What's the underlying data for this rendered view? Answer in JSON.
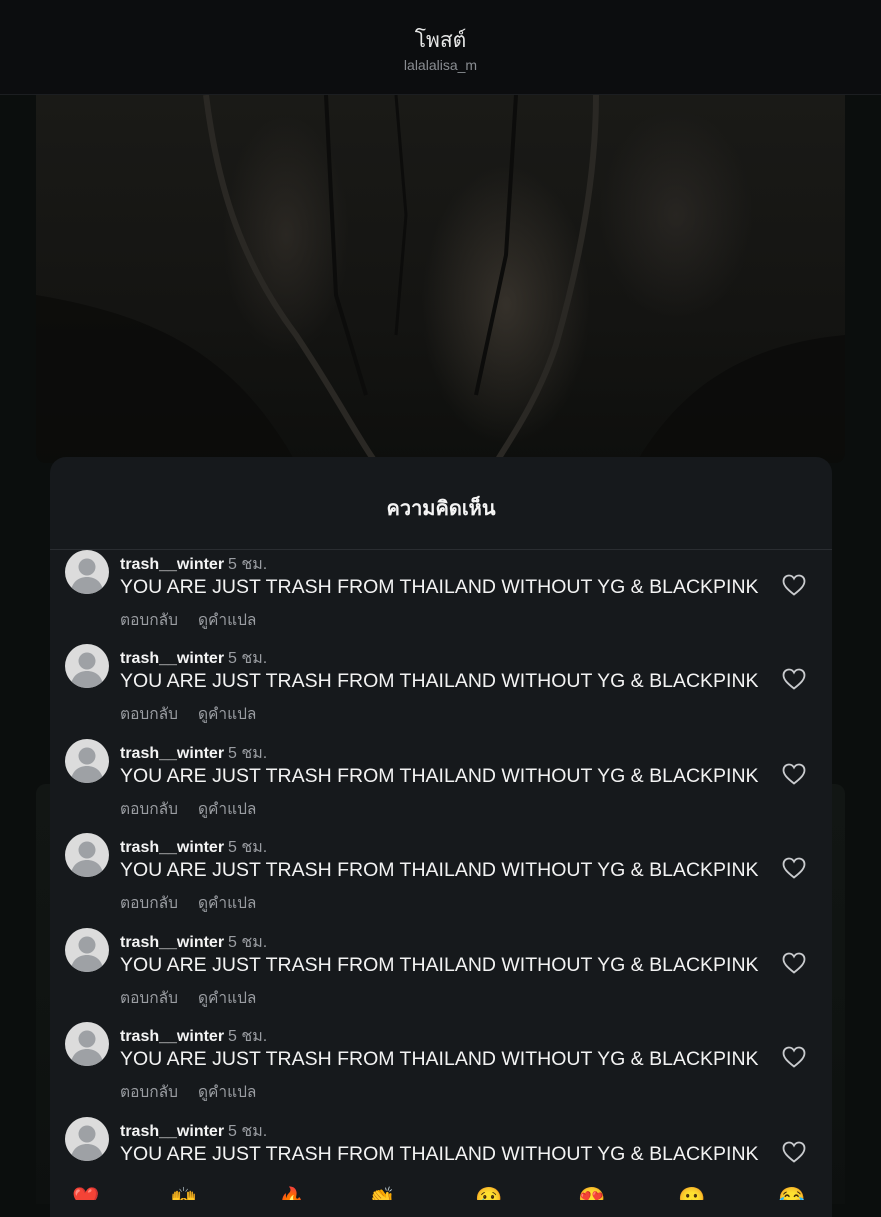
{
  "header": {
    "title": "โพสต์",
    "username": "lalalalisa_m"
  },
  "comments_sheet": {
    "title": "ความคิดเห็น",
    "comments": [
      {
        "username": "trash__winter",
        "time": "5 ชม.",
        "text": "YOU ARE JUST TRASH FROM THAILAND WITHOUT YG & BLACKPINK",
        "reply_label": "ตอบกลับ",
        "translate_label": "ดูคำแปล"
      },
      {
        "username": "trash__winter",
        "time": "5 ชม.",
        "text": "YOU ARE JUST TRASH FROM THAILAND WITHOUT YG & BLACKPINK",
        "reply_label": "ตอบกลับ",
        "translate_label": "ดูคำแปล"
      },
      {
        "username": "trash__winter",
        "time": "5 ชม.",
        "text": "YOU ARE JUST TRASH FROM THAILAND WITHOUT YG & BLACKPINK",
        "reply_label": "ตอบกลับ",
        "translate_label": "ดูคำแปล"
      },
      {
        "username": "trash__winter",
        "time": "5 ชม.",
        "text": "YOU ARE JUST TRASH FROM THAILAND WITHOUT YG & BLACKPINK",
        "reply_label": "ตอบกลับ",
        "translate_label": "ดูคำแปล"
      },
      {
        "username": "trash__winter",
        "time": "5 ชม.",
        "text": "YOU ARE JUST TRASH FROM THAILAND WITHOUT YG & BLACKPINK",
        "reply_label": "ตอบกลับ",
        "translate_label": "ดูคำแปล"
      },
      {
        "username": "trash__winter",
        "time": "5 ชม.",
        "text": "YOU ARE JUST TRASH FROM THAILAND WITHOUT YG & BLACKPINK",
        "reply_label": "ตอบกลับ",
        "translate_label": "ดูคำแปล"
      },
      {
        "username": "trash__winter",
        "time": "5 ชม.",
        "text": "YOU ARE JUST TRASH FROM THAILAND WITHOUT YG & BLACKPINK"
      }
    ]
  },
  "emoji_bar": [
    "❤️",
    "🙌",
    "🔥",
    "👏",
    "😢",
    "😍",
    "😮",
    "😂"
  ],
  "colors": {
    "background": "#0b0e0d",
    "sheet": "#16191c",
    "secondary_text": "#9a9da2"
  }
}
